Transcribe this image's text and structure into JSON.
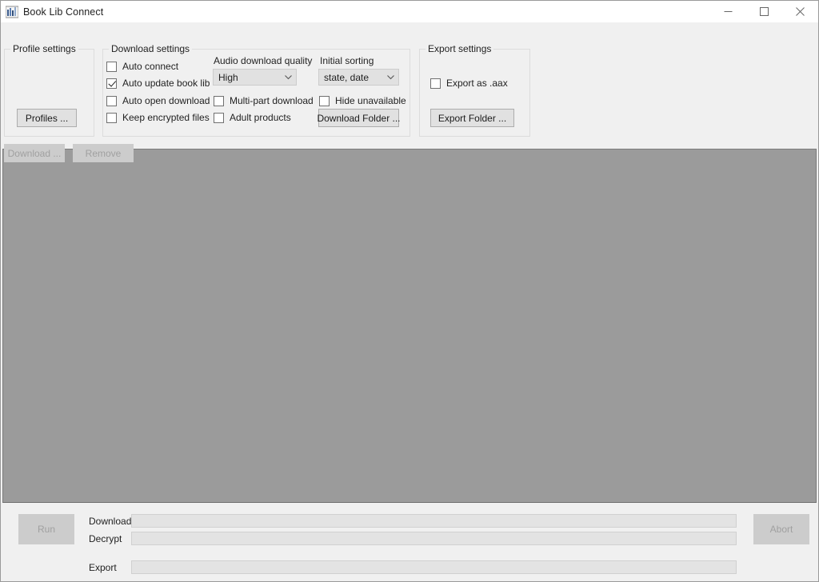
{
  "window": {
    "title": "Book Lib Connect",
    "icon": "app-chart-icon",
    "minimize_label": "─",
    "maximize_label": "□",
    "close_label": "✕"
  },
  "profile_settings": {
    "title": "Profile settings",
    "profiles_button": "Profiles ..."
  },
  "download_settings": {
    "title": "Download settings",
    "checkboxes": [
      {
        "label": "Auto connect",
        "checked": false
      },
      {
        "label": "Auto update book lib",
        "checked": true
      },
      {
        "label": "Auto open download",
        "checked": false
      },
      {
        "label": "Keep encrypted files",
        "checked": false
      }
    ],
    "audio_quality": {
      "label": "Audio download quality",
      "value": "High",
      "arrow": "∨"
    },
    "extra_checkboxes": [
      {
        "label": "Multi-part download",
        "checked": false
      },
      {
        "label": "Adult products",
        "checked": false
      }
    ],
    "initial_sorting": {
      "label": "Initial sorting",
      "value": "state, date",
      "arrow": "∨"
    },
    "hide_unavailable": {
      "label": "Hide unavailable",
      "checked": false
    },
    "download_folder_button": "Download Folder ..."
  },
  "export_settings": {
    "title": "Export settings",
    "export_as_aax": {
      "label": "Export as .aax",
      "checked": false
    },
    "export_folder_button": "Export Folder ..."
  },
  "actions": {
    "download_button": "Download ...",
    "remove_button": "Remove"
  },
  "status_bar": {
    "run_button": "Run",
    "abort_button": "Abort",
    "progress_rows": [
      {
        "label": "Download",
        "value": 0
      },
      {
        "label": "Decrypt",
        "value": 0
      },
      {
        "label": "Export",
        "value": 0
      }
    ]
  },
  "colors": {
    "window_bg": "#f0f0f0",
    "list_panel_bg": "#9b9b9b",
    "button_face": "#e1e1e1",
    "disabled_face": "#cccccc",
    "progress_track": "#e3e3e3"
  }
}
